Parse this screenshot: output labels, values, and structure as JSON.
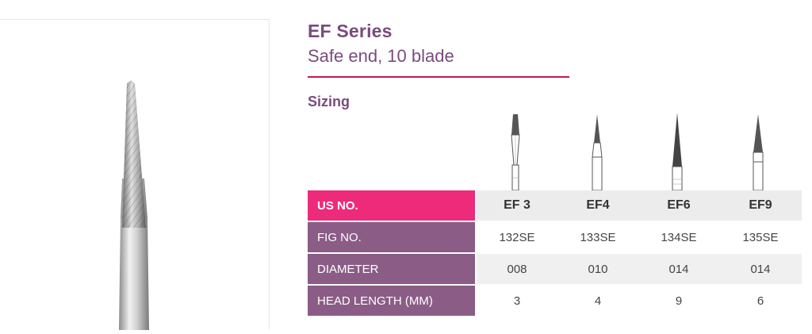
{
  "header": {
    "title": "EF Series",
    "subtitle": "Safe end, 10 blade"
  },
  "section": {
    "heading": "Sizing"
  },
  "table": {
    "columns": [
      "EF 3",
      "EF4",
      "EF6",
      "EF9"
    ],
    "rows": [
      {
        "label": "US NO.",
        "values": [
          "EF 3",
          "EF4",
          "EF6",
          "EF9"
        ]
      },
      {
        "label": "FIG NO.",
        "values": [
          "132SE",
          "133SE",
          "134SE",
          "135SE"
        ]
      },
      {
        "label": "DIAMETER",
        "values": [
          "008",
          "010",
          "014",
          "014"
        ]
      },
      {
        "label": "HEAD LENGTH (MM)",
        "values": [
          "3",
          "4",
          "9",
          "6"
        ]
      }
    ]
  },
  "colors": {
    "brand_purple": "#7a4b7d",
    "accent_pink": "#ee2a7b",
    "row_label_purple": "#8a5c86",
    "rule_magenta": "#c2185b"
  }
}
